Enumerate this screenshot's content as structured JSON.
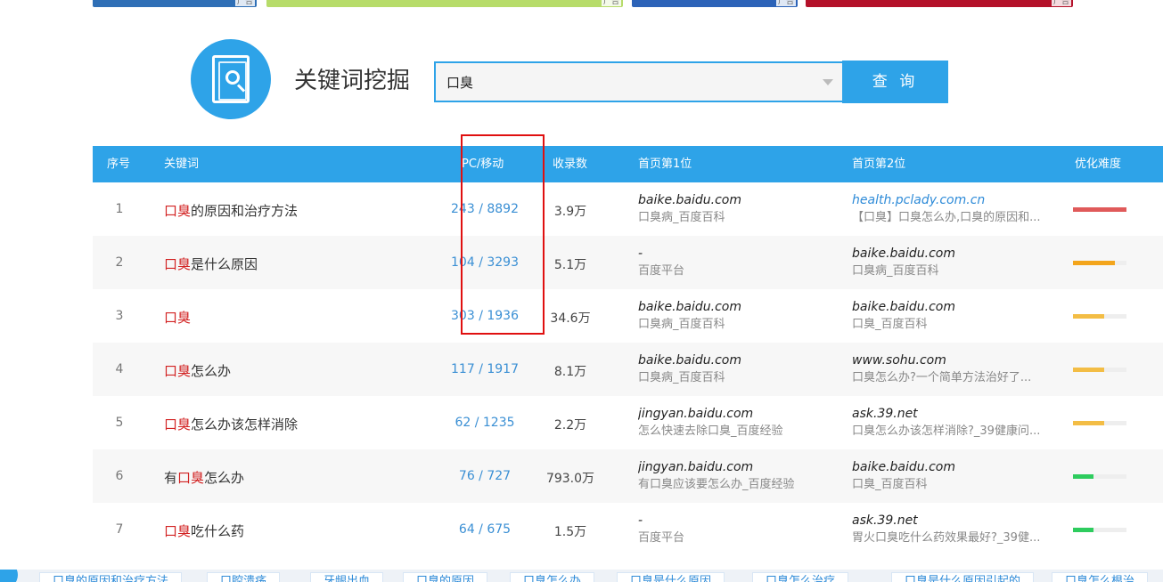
{
  "colors": {
    "accent": "#2ea3e8",
    "keyword_highlight": "#d22222",
    "link": "#2e8bd8",
    "annotation_box": "#e01010",
    "difficulty_red": "#e05a5a",
    "difficulty_orange": "#f3a51c",
    "difficulty_yellow": "#f3bd45",
    "difficulty_green": "#2ecc5e"
  },
  "header": {
    "logo_icon": "document-search-icon",
    "title": "关键词挖掘"
  },
  "search": {
    "value": "口臭",
    "button_label": "查 询"
  },
  "table": {
    "columns": {
      "index": "序号",
      "keyword": "关键词",
      "pc_mobile": "PC/移动",
      "indexed": "收录数",
      "rank1": "首页第1位",
      "rank2": "首页第2位",
      "difficulty": "优化难度"
    },
    "rows": [
      {
        "index": "1",
        "kw_pre": "",
        "kw_hl": "口臭",
        "kw_post": "的原因和治疗方法",
        "pc_mobile": "243 / 8892",
        "indexed": "3.9万",
        "r1_domain": "baike.baidu.com",
        "r1_desc": "口臭病_百度百科",
        "r2_domain": "health.pclady.com.cn",
        "r2_desc": "【口臭】口臭怎么办,口臭的原因和...",
        "difficulty": 1.0,
        "difficulty_color": "#e05a5a"
      },
      {
        "index": "2",
        "kw_pre": "",
        "kw_hl": "口臭",
        "kw_post": "是什么原因",
        "pc_mobile": "104 / 3293",
        "indexed": "5.1万",
        "r1_domain": "-",
        "r1_desc": "百度平台",
        "r2_domain": "baike.baidu.com",
        "r2_desc": "口臭病_百度百科",
        "difficulty": 0.78,
        "difficulty_color": "#f3a51c"
      },
      {
        "index": "3",
        "kw_pre": "",
        "kw_hl": "口臭",
        "kw_post": "",
        "pc_mobile": "303 / 1936",
        "indexed": "34.6万",
        "r1_domain": "baike.baidu.com",
        "r1_desc": "口臭病_百度百科",
        "r2_domain": "baike.baidu.com",
        "r2_desc": "口臭_百度百科",
        "difficulty": 0.58,
        "difficulty_color": "#f3bd45"
      },
      {
        "index": "4",
        "kw_pre": "",
        "kw_hl": "口臭",
        "kw_post": "怎么办",
        "pc_mobile": "117 / 1917",
        "indexed": "8.1万",
        "r1_domain": "baike.baidu.com",
        "r1_desc": "口臭病_百度百科",
        "r2_domain": "www.sohu.com",
        "r2_desc": "口臭怎么办?一个简单方法治好了...",
        "difficulty": 0.58,
        "difficulty_color": "#f3bd45"
      },
      {
        "index": "5",
        "kw_pre": "",
        "kw_hl": "口臭",
        "kw_post": "怎么办该怎样消除",
        "pc_mobile": "62 / 1235",
        "indexed": "2.2万",
        "r1_domain": "jingyan.baidu.com",
        "r1_desc": "怎么快速去除口臭_百度经验",
        "r2_domain": "ask.39.net",
        "r2_desc": "口臭怎么办该怎样消除?_39健康问...",
        "difficulty": 0.58,
        "difficulty_color": "#f3bd45"
      },
      {
        "index": "6",
        "kw_pre": "有",
        "kw_hl": "口臭",
        "kw_post": "怎么办",
        "pc_mobile": "76 / 727",
        "indexed": "793.0万",
        "r1_domain": "jingyan.baidu.com",
        "r1_desc": "有口臭应该要怎么办_百度经验",
        "r2_domain": "baike.baidu.com",
        "r2_desc": "口臭_百度百科",
        "difficulty": 0.38,
        "difficulty_color": "#2ecc5e"
      },
      {
        "index": "7",
        "kw_pre": "",
        "kw_hl": "口臭",
        "kw_post": "吃什么药",
        "pc_mobile": "64 / 675",
        "indexed": "1.5万",
        "r1_domain": "-",
        "r1_desc": "百度平台",
        "r2_domain": "ask.39.net",
        "r2_desc": "胃火口臭吃什么药效果最好?_39健...",
        "difficulty": 0.38,
        "difficulty_color": "#2ecc5e"
      }
    ]
  },
  "related_tags": [
    "口臭的原因和治疗方法",
    "口腔溃疡",
    "牙龈出血",
    "口臭的原因",
    "口臭怎么办",
    "口臭是什么原因",
    "口臭怎么治疗",
    "口臭是什么原因引起的",
    "口臭怎么根治"
  ]
}
